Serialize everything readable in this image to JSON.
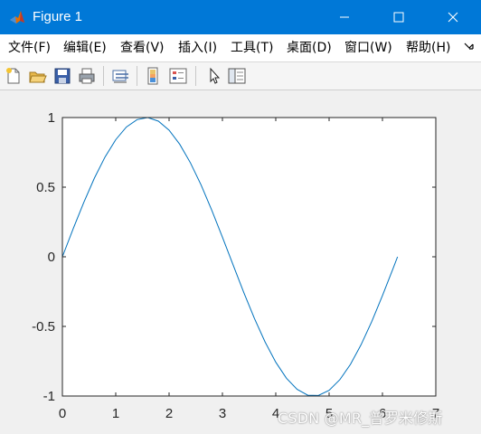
{
  "window": {
    "title": "Figure 1",
    "accent_color": "#0078d7",
    "controls": [
      "minimize-icon",
      "maximize-icon",
      "close-icon"
    ]
  },
  "menu": {
    "items": [
      "文件(F)",
      "编辑(E)",
      "查看(V)",
      "插入(I)",
      "工具(T)",
      "桌面(D)",
      "窗口(W)",
      "帮助(H)"
    ],
    "overflow_icon": "chevron-overflow-icon"
  },
  "toolbar": {
    "buttons": [
      "new-figure-icon",
      "open-file-icon",
      "save-icon",
      "print-icon",
      "link-plot-icon",
      "colorbar-icon",
      "legend-icon",
      "edit-plot-pointer-icon",
      "property-inspector-icon"
    ]
  },
  "chart_data": {
    "type": "line",
    "function": "sin(x)",
    "x": [
      0,
      0.2,
      0.4,
      0.6,
      0.8,
      1.0,
      1.2,
      1.4,
      1.6,
      1.8,
      2.0,
      2.2,
      2.4,
      2.6,
      2.8,
      3.0,
      3.2,
      3.4,
      3.6,
      3.8,
      4.0,
      4.2,
      4.4,
      4.6,
      4.8,
      5.0,
      5.2,
      5.4,
      5.6,
      5.8,
      6.0,
      6.2,
      6.2832
    ],
    "y": [
      0,
      0.199,
      0.389,
      0.565,
      0.717,
      0.841,
      0.932,
      0.985,
      1.0,
      0.974,
      0.909,
      0.808,
      0.675,
      0.516,
      0.335,
      0.141,
      -0.058,
      -0.256,
      -0.443,
      -0.612,
      -0.757,
      -0.872,
      -0.952,
      -0.994,
      -0.996,
      -0.959,
      -0.883,
      -0.773,
      -0.631,
      -0.465,
      -0.279,
      -0.083,
      0
    ],
    "xlim": [
      0,
      7
    ],
    "ylim": [
      -1,
      1
    ],
    "xticks": [
      "0",
      "1",
      "2",
      "3",
      "4",
      "5",
      "6",
      "7"
    ],
    "yticks": [
      "1",
      "0.5",
      "0",
      "-0.5",
      "-1"
    ],
    "line_color": "#0072bd",
    "grid": false
  },
  "watermark": "CSDN @MR_普罗米修斯"
}
